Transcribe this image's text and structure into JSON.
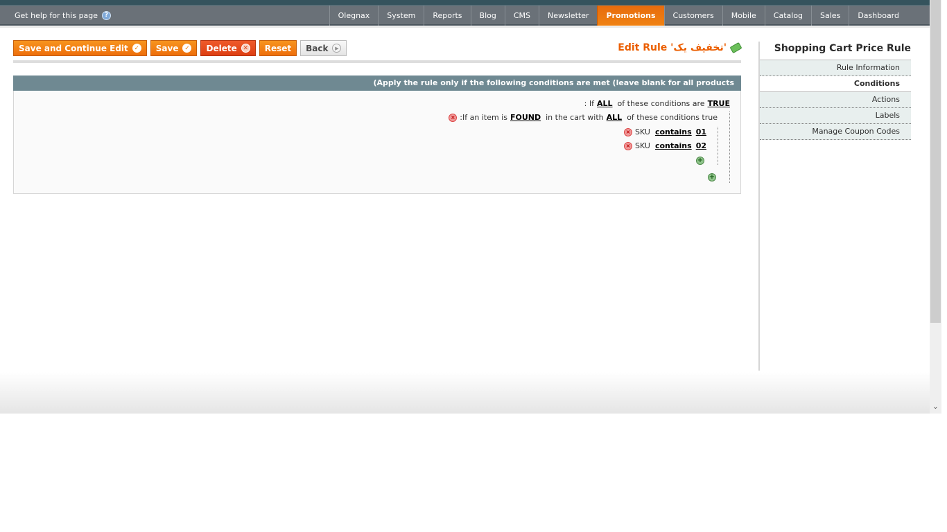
{
  "header": {
    "help_text": "Get help for this page",
    "nav": [
      {
        "label": "Olegnax",
        "active": false
      },
      {
        "label": "System",
        "active": false
      },
      {
        "label": "Reports",
        "active": false
      },
      {
        "label": "Blog",
        "active": false
      },
      {
        "label": "CMS",
        "active": false
      },
      {
        "label": "Newsletter",
        "active": false
      },
      {
        "label": "Promotions",
        "active": true
      },
      {
        "label": "Customers",
        "active": false
      },
      {
        "label": "Mobile",
        "active": false
      },
      {
        "label": "Catalog",
        "active": false
      },
      {
        "label": "Sales",
        "active": false
      },
      {
        "label": "Dashboard",
        "active": false
      }
    ]
  },
  "toolbar": {
    "save_continue": "Save and Continue Edit",
    "save": "Save",
    "delete": "Delete",
    "reset": "Reset",
    "back": "Back"
  },
  "page": {
    "title": "Edit Rule 'تخفیف یک'"
  },
  "conditions": {
    "header": "(Apply the rule only if the following conditions are met (leave blank for all products",
    "root": {
      "prefix": ": If",
      "aggregator": "ALL",
      "middle": "of these conditions are",
      "value": "TRUE"
    },
    "found": {
      "prefix": ":If an item is",
      "found_value": "FOUND",
      "middle": "in the cart with",
      "aggregator": "ALL",
      "suffix": "of these conditions true"
    },
    "items": [
      {
        "attribute": "SKU",
        "operator": "contains",
        "value": "01"
      },
      {
        "attribute": "SKU",
        "operator": "contains",
        "value": "02"
      }
    ]
  },
  "sidebar": {
    "title": "Shopping Cart Price Rule",
    "tabs": [
      {
        "label": "Rule Information",
        "active": false
      },
      {
        "label": "Conditions",
        "active": true
      },
      {
        "label": "Actions",
        "active": false
      },
      {
        "label": "Labels",
        "active": false
      },
      {
        "label": "Manage Coupon Codes",
        "active": false
      }
    ]
  },
  "colors": {
    "accent": "#eb5e00",
    "nav_bg": "#6a7178",
    "fieldset_head": "#6f8992"
  }
}
